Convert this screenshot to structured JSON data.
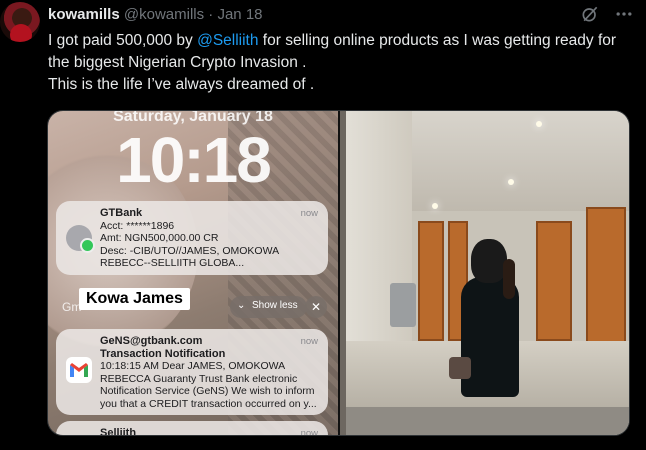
{
  "tweet": {
    "display_name": "kowamills",
    "handle": "@kowamills",
    "separator": "·",
    "date": "Jan 18",
    "text_before": "I got paid 500,000 by ",
    "mention": "@Selliith",
    "text_after": " for selling online products as I was getting ready for the biggest Nigerian Crypto Invasion .",
    "text_line2": "This is the life I’ve always dreamed of .",
    "icons": [
      "grok-icon",
      "more-icon"
    ]
  },
  "lockscreen": {
    "date": "Saturday, January 18",
    "time": "10:18",
    "notification_1": {
      "app": "GTBank",
      "time": "now",
      "line1": "Acct: ******1896",
      "line2": "Amt: NGN500,000.00 CR",
      "line3": "Desc: -CIB/UTO//JAMES, OMOKOWA",
      "line4": "REBECC--SELLIITH GLOBA..."
    },
    "group_label": "Gm",
    "caption": "Kowa James",
    "show_less": "Show less",
    "close_symbol": "✕",
    "notification_2": {
      "sender": "GeNS@gtbank.com",
      "time": "now",
      "subject": "Transaction Notification",
      "line1": "10:18:15 AM Dear JAMES, OMOKOWA",
      "line2": "REBECCA Guaranty Trust Bank electronic",
      "line3": "Notification Service (GeNS) We wish to inform",
      "line4": "you that a CREDIT transaction occurred on y..."
    },
    "notification_3": {
      "sender": "Selliith",
      "time": "now"
    }
  },
  "colors": {
    "background": "#000000",
    "text": "#e7e9ea",
    "muted": "#71767b",
    "link": "#1d9bf0"
  }
}
